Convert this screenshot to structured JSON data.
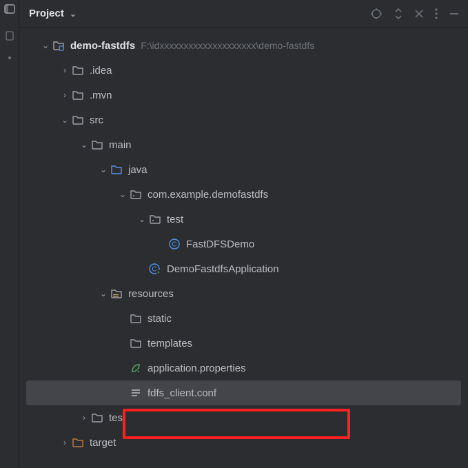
{
  "panel": {
    "title": "Project"
  },
  "root": {
    "name": "demo-fastdfs",
    "path": "F:\\idxxxxxxxxxxxxxxxxxxxx\\demo-fastdfs"
  },
  "nodes": {
    "idea": ".idea",
    "mvn": ".mvn",
    "src": "src",
    "main": "main",
    "java": "java",
    "pkg": "com.example.demofastdfs",
    "test_pkg": "test",
    "cls_fastdfsdemo": "FastDFSDemo",
    "cls_app": "DemoFastdfsApplication",
    "resources": "resources",
    "static": "static",
    "templates": "templates",
    "app_props": "application.properties",
    "fdfs_conf": "fdfs_client.conf",
    "test_dir": "test",
    "target": "target"
  }
}
